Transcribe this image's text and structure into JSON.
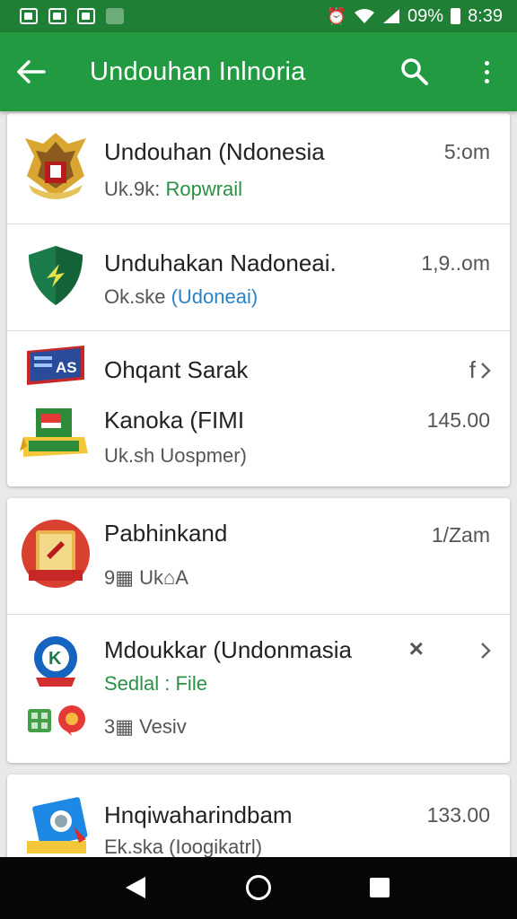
{
  "status_bar": {
    "battery": "09%",
    "time": "8:39"
  },
  "app_bar": {
    "title": "Undouhan Inlnoria"
  },
  "items": [
    {
      "title": "Undouhan (Ndonesia",
      "sub_prefix": "Uk.9k: ",
      "sub_highlight": "Ropwrail",
      "time": "5:om"
    },
    {
      "title": "Unduhakan Nadoneai.",
      "sub_prefix": "Ok.ske ",
      "sub_highlight": "(Udoneai)",
      "time": "1,9..om"
    },
    {
      "title": "Ohqant Sarak",
      "time": "f"
    },
    {
      "title": "Kanoka (FIMI",
      "sub": "Uk.sh Uospmer)",
      "time": "145.00"
    },
    {
      "title": "Pabhinkand",
      "sub": "9▦ Uk⌂A",
      "time": "1/Zam"
    },
    {
      "title": "Mdoukkar (Undonmasia",
      "sub": "Sedlal : File",
      "meta": "3▦ Vesiv",
      "mark": "×"
    },
    {
      "title": "Hnqiwaharindbam",
      "sub": "Ek.ska (Ioogikatrl)",
      "time": "133.00"
    }
  ],
  "colors": {
    "status": "#1f7f34",
    "appbar": "#219a42",
    "green": "#2a9142",
    "blue": "#2a83c5"
  },
  "icons": [
    "back-arrow-icon",
    "search-icon",
    "more-vert-icon",
    "garuda-emblem-icon",
    "shield-icon",
    "as-badge-icon",
    "certificate-icon",
    "seal-icon",
    "badge-k-icon",
    "grid-icon",
    "location-pin-icon",
    "chevron-right-icon",
    "check-icon"
  ]
}
